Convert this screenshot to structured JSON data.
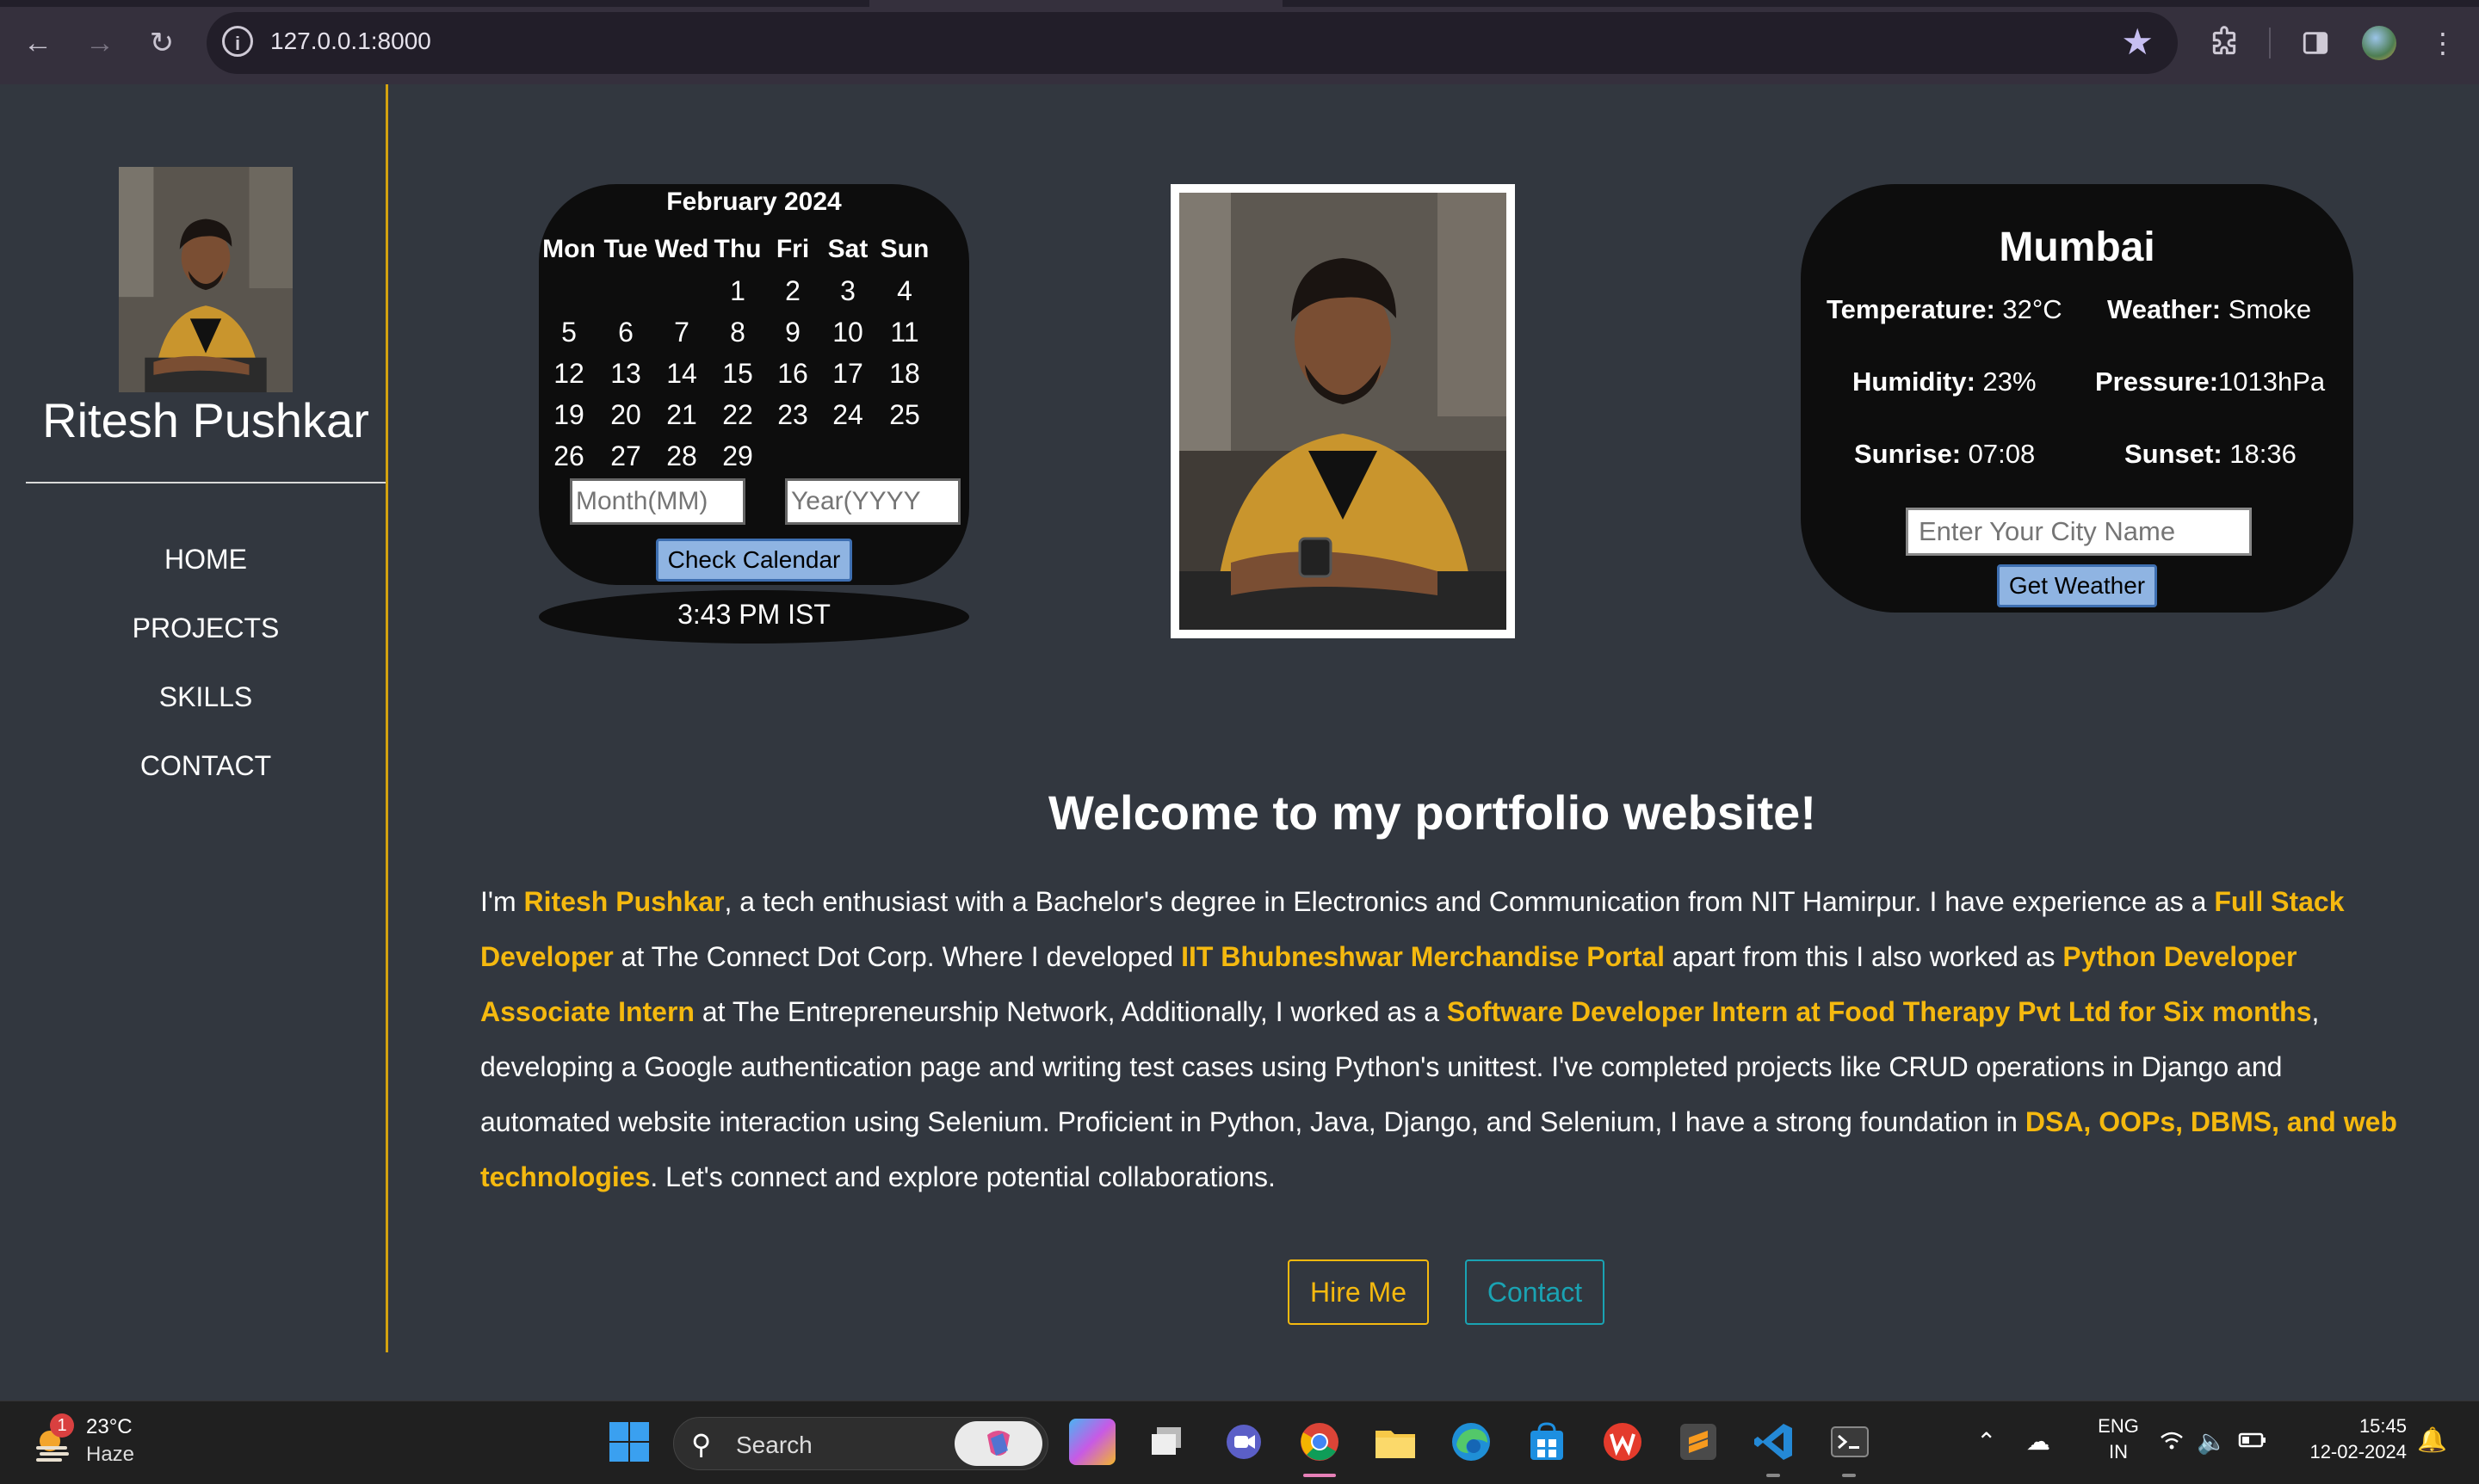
{
  "browser": {
    "url": "127.0.0.1:8000"
  },
  "sidebar": {
    "name": "Ritesh Pushkar",
    "nav": [
      "HOME",
      "PROJECTS",
      "SKILLS",
      "CONTACT"
    ]
  },
  "calendar": {
    "title": "February 2024",
    "weekdays": [
      "Mon",
      "Tue",
      "Wed",
      "Thu",
      "Fri",
      "Sat",
      "Sun"
    ],
    "weeks": [
      [
        "",
        "",
        "",
        "1",
        "2",
        "3",
        "4"
      ],
      [
        "5",
        "6",
        "7",
        "8",
        "9",
        "10",
        "11"
      ],
      [
        "12",
        "13",
        "14",
        "15",
        "16",
        "17",
        "18"
      ],
      [
        "19",
        "20",
        "21",
        "22",
        "23",
        "24",
        "25"
      ],
      [
        "26",
        "27",
        "28",
        "29",
        "",
        "",
        ""
      ]
    ],
    "month_placeholder": "Month(MM)",
    "year_placeholder": "Year(YYYY",
    "button": "Check Calendar",
    "clock": "3:43 PM IST"
  },
  "weather": {
    "city": "Mumbai",
    "temperature_label": "Temperature:",
    "temperature_value": " 32°C",
    "weather_label": "Weather:",
    "weather_value": " Smoke",
    "humidity_label": "Humidity:",
    "humidity_value": " 23%",
    "pressure_label": "Pressure:",
    "pressure_value": "1013hPa",
    "sunrise_label": "Sunrise:",
    "sunrise_value": " 07:08",
    "sunset_label": "Sunset:",
    "sunset_value": " 18:36",
    "input_placeholder": "Enter Your City Name",
    "button": "Get Weather"
  },
  "main": {
    "welcome": "Welcome to my portfolio website!",
    "about": [
      {
        "t": "I'm ",
        "h": false
      },
      {
        "t": "Ritesh Pushkar",
        "h": true
      },
      {
        "t": ", a tech enthusiast with a Bachelor's degree in Electronics and Communication from NIT Hamirpur. I have experience as a ",
        "h": false
      },
      {
        "t": "Full Stack Developer",
        "h": true
      },
      {
        "t": " at The Connect Dot Corp. Where I developed ",
        "h": false
      },
      {
        "t": "IIT Bhubneshwar Merchandise Portal",
        "h": true
      },
      {
        "t": " apart from this I also worked as ",
        "h": false
      },
      {
        "t": "Python Developer Associate Intern",
        "h": true
      },
      {
        "t": " at The Entrepreneurship Network, Additionally, I worked as a ",
        "h": false
      },
      {
        "t": "Software Developer Intern at Food Therapy Pvt Ltd for Six months",
        "h": true
      },
      {
        "t": ", developing a Google authentication page and writing test cases using Python's unittest. I've completed projects like CRUD operations in Django and automated website interaction using Selenium. Proficient in Python, Java, Django, and Selenium, I have a strong foundation in ",
        "h": false
      },
      {
        "t": "DSA, OOPs, DBMS, and web technologies",
        "h": true
      },
      {
        "t": ". Let's connect and explore potential collaborations.",
        "h": false
      }
    ],
    "hire_button": "Hire Me",
    "contact_button": "Contact"
  },
  "taskbar": {
    "weather_temp": "23°C",
    "weather_cond": "Haze",
    "weather_badge": "1",
    "search_label": "Search",
    "lang_line1": "ENG",
    "lang_line2": "IN",
    "time": "15:45",
    "date": "12-02-2024"
  },
  "colors": {
    "accent": "#f5b90f",
    "contact_accent": "#1aa3b3",
    "page_bg": "#32373f",
    "widget_bg": "#0d0d0d"
  }
}
